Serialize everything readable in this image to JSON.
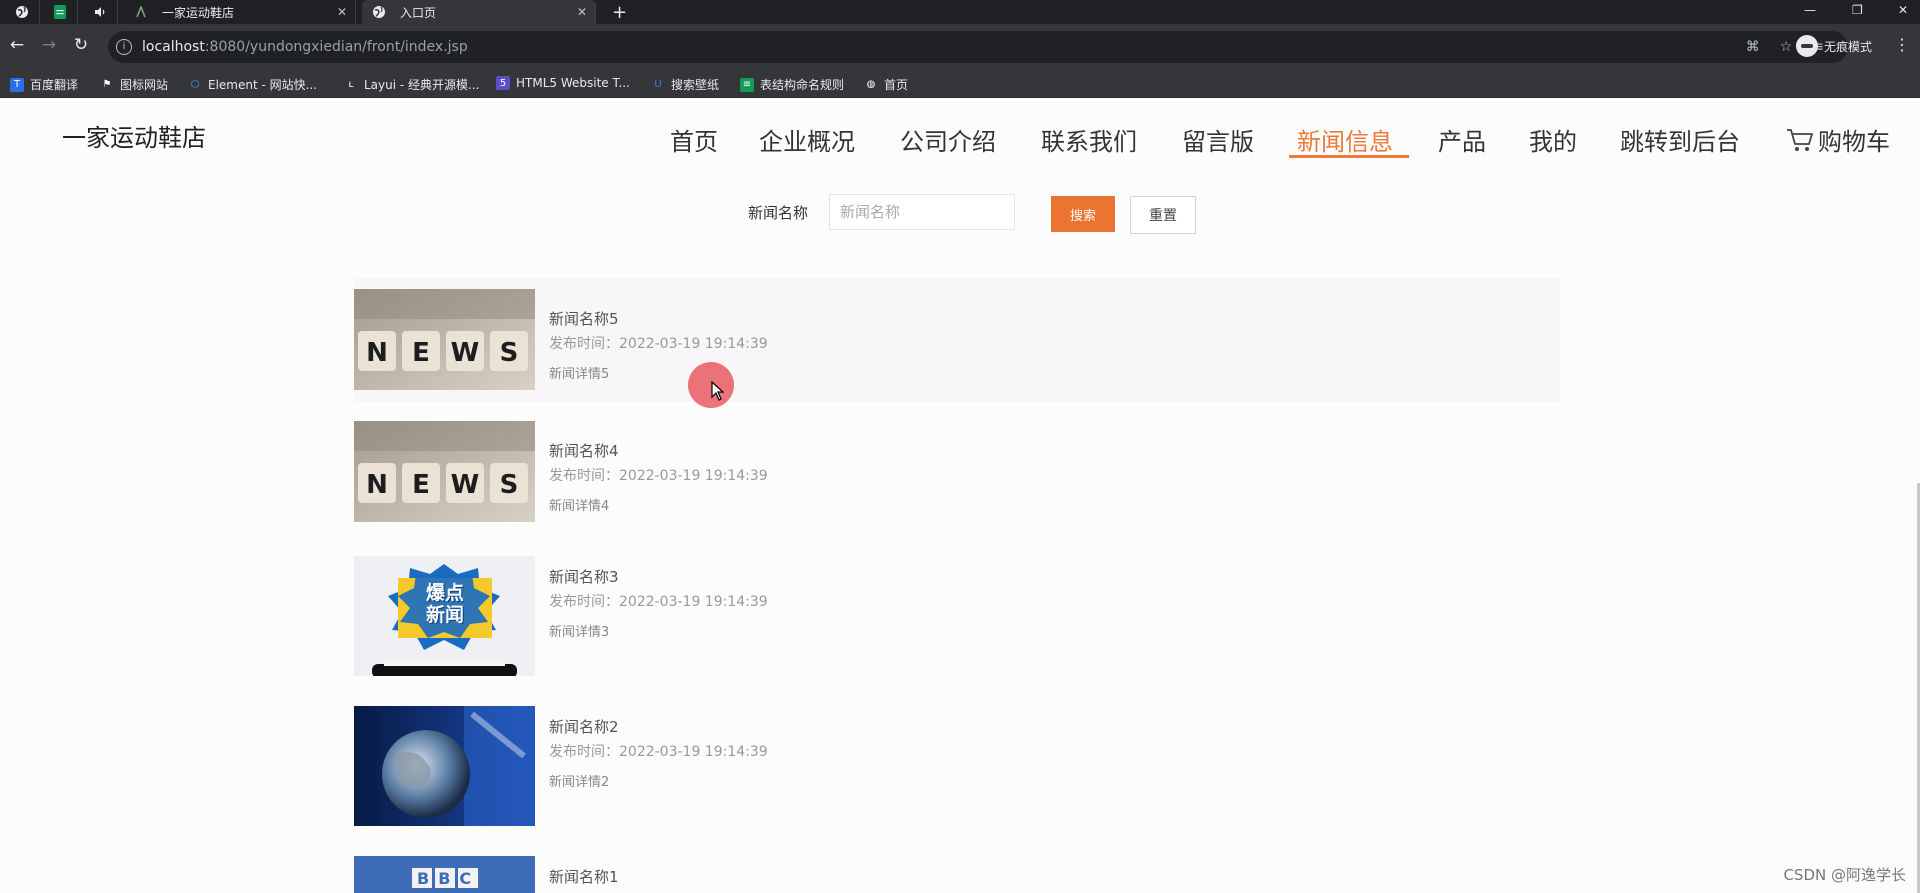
{
  "browser": {
    "tabs": [
      {
        "title": "",
        "icon": "globe-icon"
      },
      {
        "title": "",
        "icon": "sheet-icon"
      },
      {
        "title": "",
        "icon": "speaker-icon"
      },
      {
        "title": "一家运动鞋店",
        "icon": "page-icon"
      },
      {
        "title": "入口页",
        "icon": "globe-icon"
      }
    ],
    "url_host": "localhost",
    "url_path": ":8080/yundongxiedian/front/index.jsp",
    "profile_label": "无痕模式",
    "bookmarks": [
      {
        "label": "百度翻译",
        "icon": "translate-icon",
        "color": "#2a6ee8"
      },
      {
        "label": "图标网站",
        "icon": "flag-icon",
        "color": "#35363a"
      },
      {
        "label": "Element - 网站快...",
        "icon": "element-icon",
        "color": "#409eff"
      },
      {
        "label": "Layui - 经典开源模...",
        "icon": "layui-icon",
        "color": "#35363a"
      },
      {
        "label": "HTML5 Website T...",
        "icon": "html5-icon",
        "color": "#5b4fc5"
      },
      {
        "label": "搜索壁纸",
        "icon": "wallpaper-icon",
        "color": "#3b7ddd"
      },
      {
        "label": "表结构命名规则",
        "icon": "sheet-icon",
        "color": "#0f9d58"
      },
      {
        "label": "首页",
        "icon": "globe-icon",
        "color": "#35363a"
      }
    ]
  },
  "site": {
    "brand": "一家运动鞋店",
    "accent_color": "#ec7a3b",
    "nav": [
      {
        "label": "首页",
        "active": false
      },
      {
        "label": "企业概况",
        "active": false
      },
      {
        "label": "公司介绍",
        "active": false
      },
      {
        "label": "联系我们",
        "active": false
      },
      {
        "label": "留言版",
        "active": false
      },
      {
        "label": "新闻信息",
        "active": true
      },
      {
        "label": "产品",
        "active": false
      },
      {
        "label": "我的",
        "active": false
      },
      {
        "label": "跳转到后台",
        "active": false
      },
      {
        "label": "购物车",
        "active": false
      }
    ]
  },
  "search": {
    "label": "新闻名称",
    "placeholder": "新闻名称",
    "value": "",
    "search_button": "搜索",
    "reset_button": "重置"
  },
  "news": [
    {
      "title": "新闻名称5",
      "time": "发布时间：2022-03-19 19:14:39",
      "detail": "新闻详情5",
      "thumb": "news-cubes"
    },
    {
      "title": "新闻名称4",
      "time": "发布时间：2022-03-19 19:14:39",
      "detail": "新闻详情4",
      "thumb": "news-cubes"
    },
    {
      "title": "新闻名称3",
      "time": "发布时间：2022-03-19 19:14:39",
      "detail": "新闻详情3",
      "thumb": "breaking-news",
      "thumb_text": "爆点新闻"
    },
    {
      "title": "新闻名称2",
      "time": "发布时间：2022-03-19 19:14:39",
      "detail": "新闻详情2",
      "thumb": "globe"
    },
    {
      "title": "新闻名称1",
      "time": "",
      "detail": "",
      "thumb": "bbc",
      "thumb_text": "BBC"
    }
  ],
  "watermark": "CSDN @阿逸学长"
}
